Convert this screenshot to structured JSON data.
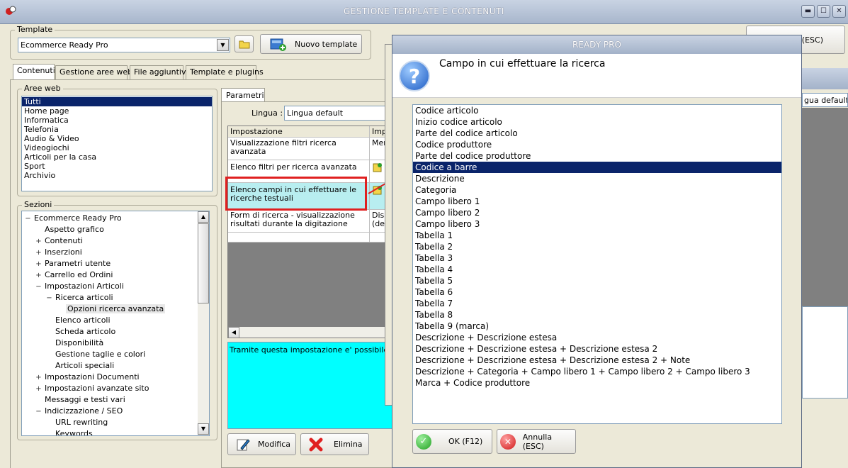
{
  "window": {
    "title": "GESTIONE TEMPLATE E CONTENUTI",
    "minimize": "▬",
    "maximize": "☐",
    "close": "✕"
  },
  "template": {
    "group_label": "Template",
    "selected": "Ecommerce Ready Pro",
    "new_button": "Nuovo template"
  },
  "bg_button": {
    "label": "a (ESC)"
  },
  "tabs": [
    "Contenuti",
    "Gestione aree web",
    "File aggiuntivi",
    "Template e plugins"
  ],
  "aree_web": {
    "label": "Aree web",
    "items": [
      "Tutti",
      "Home page",
      "Informatica",
      "Telefonia",
      "Audio & Video",
      "Videogiochi",
      "Articoli per la casa",
      "Sport",
      "Archivio"
    ]
  },
  "sezioni": {
    "label": "Sezioni",
    "items": [
      {
        "label": "Ecommerce Ready Pro",
        "exp": "−"
      },
      {
        "label": "Aspetto grafico",
        "exp": ""
      },
      {
        "label": "Contenuti",
        "exp": "+"
      },
      {
        "label": "Inserzioni",
        "exp": "+"
      },
      {
        "label": "Parametri utente",
        "exp": "+"
      },
      {
        "label": "Carrello ed Ordini",
        "exp": "+"
      },
      {
        "label": "Impostazioni Articoli",
        "exp": "−"
      },
      {
        "label": "Ricerca articoli",
        "exp": "−"
      },
      {
        "label": "Opzioni ricerca avanzata",
        "exp": ""
      },
      {
        "label": "Elenco articoli",
        "exp": ""
      },
      {
        "label": "Scheda articolo",
        "exp": ""
      },
      {
        "label": "Disponibilità",
        "exp": ""
      },
      {
        "label": "Gestione taglie e colori",
        "exp": ""
      },
      {
        "label": "Articoli speciali",
        "exp": ""
      },
      {
        "label": "Impostazioni Documenti",
        "exp": "+"
      },
      {
        "label": "Impostazioni avanzate sito",
        "exp": "+"
      },
      {
        "label": "Messaggi e testi vari",
        "exp": ""
      },
      {
        "label": "Indicizzazione / SEO",
        "exp": "−"
      },
      {
        "label": "URL rewriting",
        "exp": ""
      },
      {
        "label": "Keywords",
        "exp": ""
      }
    ]
  },
  "parametri": {
    "tab": "Parametri",
    "lingua_label": "Lingua :",
    "lingua_value": "Lingua default",
    "right_lingua": "gua default",
    "col_impostazione": "Impostazione",
    "col_valore": "Imp",
    "rows": [
      {
        "setting": "Visualizzazione filtri ricerca avanzata",
        "value": "Men"
      },
      {
        "setting": "Elenco filtri per ricerca avanzata",
        "value": ""
      },
      {
        "setting": "Elenco campi in cui effettuare le ricerche testuali",
        "value": ""
      },
      {
        "setting": "Form di ricerca - visualizzazione risultati durante la digitazione",
        "value": "Disa (defa"
      }
    ],
    "description": "Tramite questa impostazione e' possibile scegli",
    "modifica": "Modifica",
    "elimina": "Elimina"
  },
  "dialog": {
    "title": "READY PRO",
    "question": "Campo in cui effettuare la ricerca",
    "options": [
      "Codice articolo",
      "Inizio codice articolo",
      "Parte del codice articolo",
      "Codice produttore",
      "Parte del codice produttore",
      "Codice a barre",
      "Descrizione",
      "Categoria",
      "Campo libero 1",
      "Campo libero 2",
      "Campo libero 3",
      "Tabella 1",
      "Tabella 2",
      "Tabella 3",
      "Tabella 4",
      "Tabella 5",
      "Tabella 6",
      "Tabella 7",
      "Tabella 8",
      "Tabella 9 (marca)",
      "Descrizione + Descrizione estesa",
      "Descrizione + Descrizione estesa + Descrizione estesa 2",
      "Descrizione + Descrizione estesa + Descrizione estesa 2 + Note",
      "Descrizione + Categoria + Campo libero 1 + Campo libero 2 + Campo libero 3",
      "Marca + Codice produttore"
    ],
    "selected_index": 5,
    "ok": "OK (F12)",
    "cancel": "Annulla (ESC)"
  },
  "colors": {
    "selection": "#0a246a",
    "highlight_border": "#e02020",
    "description_bg": "#00ffff",
    "row_highlight": "#b8eef0"
  }
}
